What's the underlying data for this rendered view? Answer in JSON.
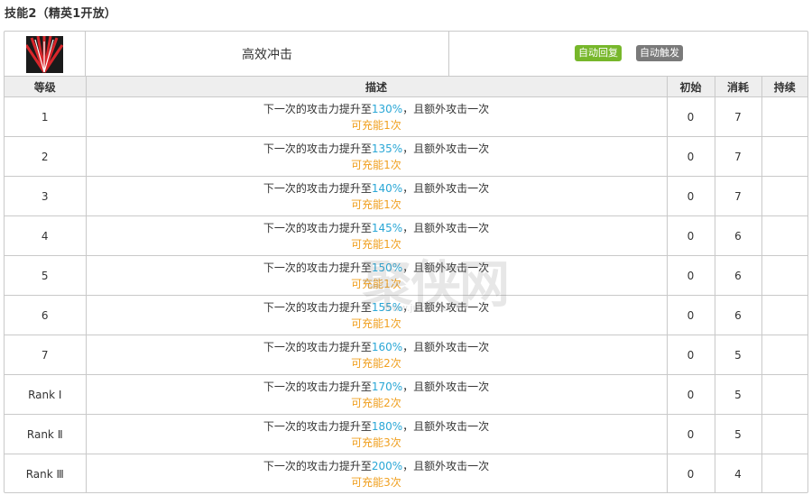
{
  "skill_title": "技能2（精英1开放）",
  "skill": {
    "icon": "skill-burst-icon",
    "name": "高效冲击",
    "badges": [
      "自动回复",
      "自动触发"
    ]
  },
  "table": {
    "headers": [
      "等级",
      "描述",
      "初始",
      "消耗",
      "持续"
    ],
    "rows": [
      {
        "level": "1",
        "desc_pre": "下一次的攻击力提升至",
        "value": "130%",
        "desc_post": "，且额外攻击一次",
        "charges": "可充能1次",
        "initial": "0",
        "cost": "7",
        "duration": ""
      },
      {
        "level": "2",
        "desc_pre": "下一次的攻击力提升至",
        "value": "135%",
        "desc_post": "，且额外攻击一次",
        "charges": "可充能1次",
        "initial": "0",
        "cost": "7",
        "duration": ""
      },
      {
        "level": "3",
        "desc_pre": "下一次的攻击力提升至",
        "value": "140%",
        "desc_post": "，且额外攻击一次",
        "charges": "可充能1次",
        "initial": "0",
        "cost": "7",
        "duration": ""
      },
      {
        "level": "4",
        "desc_pre": "下一次的攻击力提升至",
        "value": "145%",
        "desc_post": "，且额外攻击一次",
        "charges": "可充能1次",
        "initial": "0",
        "cost": "6",
        "duration": ""
      },
      {
        "level": "5",
        "desc_pre": "下一次的攻击力提升至",
        "value": "150%",
        "desc_post": "，且额外攻击一次",
        "charges": "可充能1次",
        "initial": "0",
        "cost": "6",
        "duration": ""
      },
      {
        "level": "6",
        "desc_pre": "下一次的攻击力提升至",
        "value": "155%",
        "desc_post": "，且额外攻击一次",
        "charges": "可充能1次",
        "initial": "0",
        "cost": "6",
        "duration": ""
      },
      {
        "level": "7",
        "desc_pre": "下一次的攻击力提升至",
        "value": "160%",
        "desc_post": "，且额外攻击一次",
        "charges": "可充能2次",
        "initial": "0",
        "cost": "5",
        "duration": ""
      },
      {
        "level": "Rank Ⅰ",
        "desc_pre": "下一次的攻击力提升至",
        "value": "170%",
        "desc_post": "，且额外攻击一次",
        "charges": "可充能2次",
        "initial": "0",
        "cost": "5",
        "duration": ""
      },
      {
        "level": "Rank Ⅱ",
        "desc_pre": "下一次的攻击力提升至",
        "value": "180%",
        "desc_post": "，且额外攻击一次",
        "charges": "可充能3次",
        "initial": "0",
        "cost": "5",
        "duration": ""
      },
      {
        "level": "Rank Ⅲ",
        "desc_pre": "下一次的攻击力提升至",
        "value": "200%",
        "desc_post": "，且额外攻击一次",
        "charges": "可充能3次",
        "initial": "0",
        "cost": "4",
        "duration": ""
      }
    ]
  },
  "watermark": {
    "text": "聚侠网",
    "url": "www.juxia.com"
  },
  "colors": {
    "value": "#2aa7d6",
    "charges": "#f0a020",
    "badge_green": "#77b72b",
    "badge_gray": "#7a7a7a",
    "header_bg": "#eeeeee",
    "border": "#c9c9c9"
  }
}
